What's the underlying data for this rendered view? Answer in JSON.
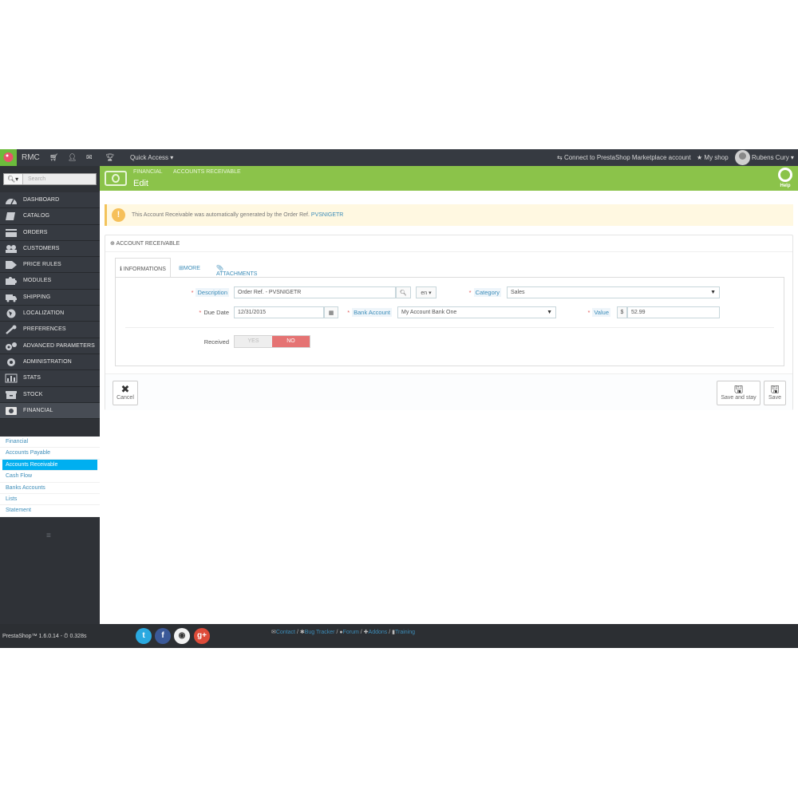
{
  "topbar": {
    "shop_name": "RMC",
    "quick_access": "Quick Access ▾",
    "connect": "Connect to PrestaShop Marketplace account",
    "my_shop": "My shop",
    "user": "Rubens Cury ▾"
  },
  "sidebar": {
    "search_placeholder": "Search",
    "menu": [
      {
        "label": "DASHBOARD",
        "icon": "dashboard-icon"
      },
      {
        "label": "CATALOG",
        "icon": "book-icon"
      },
      {
        "label": "ORDERS",
        "icon": "credit-card-icon"
      },
      {
        "label": "CUSTOMERS",
        "icon": "users-icon"
      },
      {
        "label": "PRICE RULES",
        "icon": "tag-icon"
      },
      {
        "label": "MODULES",
        "icon": "puzzle-icon"
      },
      {
        "label": "SHIPPING",
        "icon": "truck-icon"
      },
      {
        "label": "LOCALIZATION",
        "icon": "globe-icon"
      },
      {
        "label": "PREFERENCES",
        "icon": "wrench-icon"
      },
      {
        "label": "ADVANCED PARAMETERS",
        "icon": "cogs-icon"
      },
      {
        "label": "ADMINISTRATION",
        "icon": "gear-icon"
      },
      {
        "label": "STATS",
        "icon": "bar-chart-icon"
      },
      {
        "label": "STOCK",
        "icon": "archive-icon"
      },
      {
        "label": "FINANCIAL",
        "icon": "money-icon"
      }
    ],
    "submenu": [
      {
        "label": "Financial"
      },
      {
        "label": "Accounts Payable"
      },
      {
        "label": "Accounts Receivable"
      },
      {
        "label": "Cash Flow"
      },
      {
        "label": "Banks Accounts"
      },
      {
        "label": "Lists"
      },
      {
        "label": "Statement"
      }
    ]
  },
  "header": {
    "breadcrumb_1": "FINANCIAL",
    "breadcrumb_2": "ACCOUNTS RECEIVABLE",
    "title": "Edit",
    "help": "Help"
  },
  "warning": {
    "text": "This Account Receivable was automatically generated by the Order Ref.",
    "ref": "PVSNIGETR"
  },
  "panel": {
    "heading": "ACCOUNT RECEIVABLE",
    "tabs": [
      "INFORMATIONS",
      "MORE",
      "ATTACHMENTS"
    ],
    "description_label": "Description",
    "description_value": "Order Ref. - PVSNIGETR",
    "lang": "en ▾",
    "category_label": "Category",
    "category_value": "Sales",
    "due_date_label": "Due Date",
    "due_date_value": "12/31/2015",
    "bank_account_label": "Bank Account",
    "bank_account_value": "My Account Bank One",
    "value_label": "Value",
    "currency": "$",
    "value_value": "52.99",
    "received_label": "Received",
    "yes": "YES",
    "no": "NO",
    "cancel": "Cancel",
    "save_and_stay": "Save and stay",
    "save": "Save"
  },
  "footer": {
    "version": "PrestaShop™ 1.6.0.14 - ⏱ 0.328s",
    "contact": "Contact",
    "bug_tracker": "Bug Tracker",
    "forum": "Forum",
    "addons": "Addons",
    "training": "Training",
    "sep": "/"
  },
  "colors": {
    "header_green": "#8bc34a",
    "sidebar": "#363a41",
    "accent_blue": "#00aff0",
    "no_red": "#e57373"
  }
}
